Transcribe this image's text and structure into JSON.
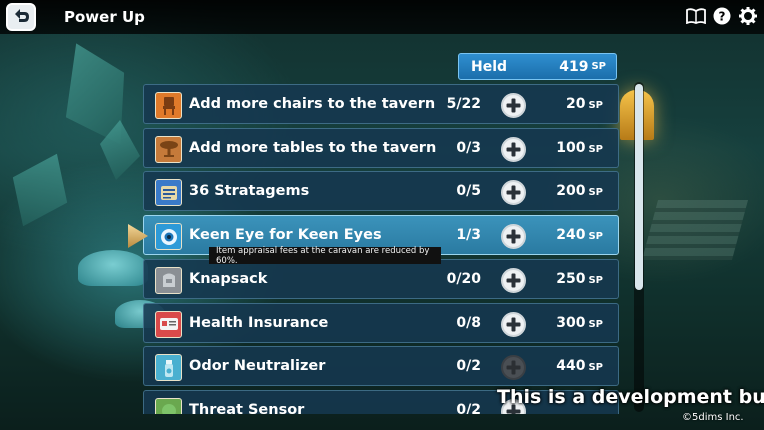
{
  "header": {
    "title": "Power Up",
    "icons": [
      "back-arrow-icon",
      "book-icon",
      "help-icon",
      "gear-icon"
    ]
  },
  "held": {
    "label": "Held",
    "value": "419",
    "unit": "SP"
  },
  "items": [
    {
      "name": "Add more chairs to the tavern",
      "count": "5/22",
      "cost": "20",
      "unit": "SP",
      "icon": "chair-icon",
      "icon_color": "#e07a2a",
      "plus_enabled": true
    },
    {
      "name": "Add more tables to the tavern",
      "count": "0/3",
      "cost": "100",
      "unit": "SP",
      "icon": "table-icon",
      "icon_color": "#c57a3a",
      "plus_enabled": true
    },
    {
      "name": "36 Stratagems",
      "count": "0/5",
      "cost": "200",
      "unit": "SP",
      "icon": "scroll-icon",
      "icon_color": "#3a7ac9",
      "plus_enabled": true
    },
    {
      "name": "Keen Eye for Keen Eyes",
      "count": "1/3",
      "cost": "240",
      "unit": "SP",
      "icon": "eye-icon",
      "icon_color": "#2d9ad8",
      "plus_enabled": true
    },
    {
      "name": "Knapsack",
      "count": "0/20",
      "cost": "250",
      "unit": "SP",
      "icon": "knapsack-icon",
      "icon_color": "#8a8f94",
      "plus_enabled": true
    },
    {
      "name": "Health Insurance",
      "count": "0/8",
      "cost": "300",
      "unit": "SP",
      "icon": "card-icon",
      "icon_color": "#d94a4a",
      "plus_enabled": true
    },
    {
      "name": "Odor Neutralizer",
      "count": "0/2",
      "cost": "440",
      "unit": "SP",
      "icon": "spray-icon",
      "icon_color": "#4ab0d0",
      "plus_enabled": false
    },
    {
      "name": "Threat Sensor",
      "count": "0/2",
      "cost": "",
      "unit": "",
      "icon": "sensor-icon",
      "icon_color": "#6aa84f",
      "plus_enabled": true
    }
  ],
  "tooltip": "Item appraisal fees at the caravan are reduced by 60%.",
  "dev_note": "This is a development build.",
  "copyright": "©5dims Inc.",
  "colors": {
    "held_bg": "#2f8fd0",
    "row_bg": "#163850",
    "row_selected": "#3b93bb"
  }
}
